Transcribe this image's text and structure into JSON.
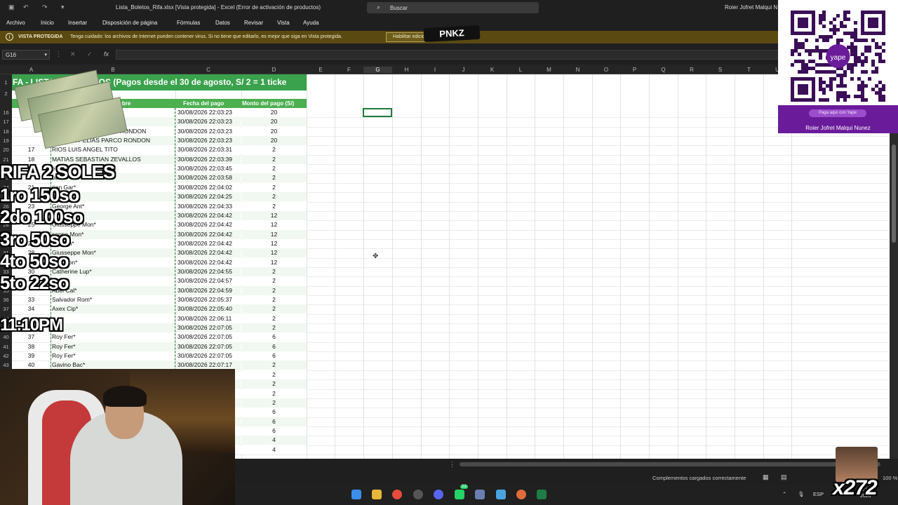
{
  "window": {
    "title": "Lista_Boletos_Rifa.xlsx  [Vista protegida]  -  Excel (Error de activación de productos)",
    "search_placeholder": "Buscar",
    "user": "Roier Jofret Malqui N"
  },
  "ribbon": {
    "tabs": [
      "Archivo",
      "Inicio",
      "Insertar",
      "Disposición de página",
      "Fórmulas",
      "Datos",
      "Revisar",
      "Vista",
      "Ayuda"
    ]
  },
  "protected_view": {
    "label": "VISTA PROTEGIDA",
    "message": "Tenga cuidado: los archivos de Internet pueden contener virus. Si no tiene que editarlo, es mejor que siga en Vista protegida.",
    "enable_button": "Habilitar edición"
  },
  "formula_bar": {
    "name_box": "G16",
    "fx": "fx",
    "cancel": "✕",
    "enter": "✓"
  },
  "columns": [
    "A",
    "B",
    "C",
    "D",
    "E",
    "F",
    "G",
    "H",
    "I",
    "J",
    "K",
    "L",
    "M",
    "N",
    "O",
    "P",
    "Q",
    "R",
    "S",
    "T",
    "U"
  ],
  "sheet": {
    "banner": "FA - LISTA DE BOLETOS (Pagos desde el 30 de agosto, S/ 2 = 1 ticke",
    "headers": {
      "b": "nombre",
      "c": "Fecha del pago",
      "d": "Monto del pago (S/)"
    },
    "row_numbers": [
      "1",
      "2",
      "16",
      "17",
      "18",
      "19",
      "20",
      "21",
      "22",
      "23",
      "24",
      "25",
      "26",
      "27",
      "28",
      "29",
      "30",
      "31",
      "32",
      "33",
      "34",
      "35",
      "36",
      "37",
      "38",
      "39",
      "40",
      "41",
      "42",
      "43"
    ],
    "rows": [
      {
        "a": "",
        "b": "ELIAS PARCO RONDON",
        "c": "30/08/2026 22:03:23",
        "d": "20"
      },
      {
        "a": "",
        "b": "Y ELIAS PARCO RONDON",
        "c": "30/08/2026 22:03:23",
        "d": "20"
      },
      {
        "a": "",
        "b": "NTHONY ELIAS PARCO RONDON",
        "c": "30/08/2026 22:03:23",
        "d": "20"
      },
      {
        "a": "",
        "b": "ANTHONY ELIAS PARCO RONDON",
        "c": "30/08/2026 22:03:23",
        "d": "20"
      },
      {
        "a": "17",
        "b": "RIOS LUIS ANGEL TITO",
        "c": "30/08/2026 22:03:31",
        "d": "2"
      },
      {
        "a": "18",
        "b": "MATIAS SEBASTIAN ZEVALLOS",
        "c": "30/08/2026 22:03:39",
        "d": "2"
      },
      {
        "a": "",
        "b": "el",
        "c": "30/08/2026 22:03:45",
        "d": "2"
      },
      {
        "a": "",
        "b": "obb",
        "c": "30/08/2026 22:03:58",
        "d": "2"
      },
      {
        "a": "21",
        "b": "rian Gar*",
        "c": "30/08/2026 22:04:02",
        "d": "2"
      },
      {
        "a": "",
        "b": "l*",
        "c": "30/08/2026 22:04:25",
        "d": "2"
      },
      {
        "a": "23",
        "b": "George Ant*",
        "c": "30/08/2026 22:04:33",
        "d": "2"
      },
      {
        "a": "",
        "b": "on*",
        "c": "30/08/2026 22:04:42",
        "d": "12"
      },
      {
        "a": "25",
        "b": "Giusseppe Mon*",
        "c": "30/08/2026 22:04:42",
        "d": "12"
      },
      {
        "a": "",
        "b": "seppe Mon*",
        "c": "30/08/2026 22:04:42",
        "d": "12"
      },
      {
        "a": "27",
        "b": "pe Mon*",
        "c": "30/08/2026 22:04:42",
        "d": "12"
      },
      {
        "a": "28",
        "b": "Giusseppe Mon*",
        "c": "30/08/2026 22:04:42",
        "d": "12"
      },
      {
        "a": "",
        "b": "ppe Mon*",
        "c": "30/08/2026 22:04:42",
        "d": "12"
      },
      {
        "a": "30",
        "b": "Catherine Lup*",
        "c": "30/08/2026 22:04:55",
        "d": "2"
      },
      {
        "a": "",
        "b": "",
        "c": "30/08/2026 22:04:57",
        "d": "2"
      },
      {
        "a": "",
        "b": "Abel Cal*",
        "c": "30/08/2026 22:04:59",
        "d": "2"
      },
      {
        "a": "33",
        "b": "Salvador Rom*",
        "c": "30/08/2026 22:05:37",
        "d": "2"
      },
      {
        "a": "34",
        "b": "Axex Cip*",
        "c": "30/08/2026 22:05:40",
        "d": "2"
      },
      {
        "a": "",
        "b": "",
        "c": "30/08/2026 22:06:11",
        "d": "2"
      },
      {
        "a": "",
        "b": "",
        "c": "30/08/2026 22:07:05",
        "d": "2"
      },
      {
        "a": "37",
        "b": "Roy Fer*",
        "c": "30/08/2026 22:07:05",
        "d": "6"
      },
      {
        "a": "38",
        "b": "Roy Fer*",
        "c": "30/08/2026 22:07:05",
        "d": "6"
      },
      {
        "a": "39",
        "b": "Roy Fer*",
        "c": "30/08/2026 22:07:05",
        "d": "6"
      },
      {
        "a": "40",
        "b": "Gavino Bac*",
        "c": "30/08/2026 22:07:17",
        "d": "2"
      },
      {
        "a": "",
        "b": "",
        "c": "",
        "d": "2"
      },
      {
        "a": "",
        "b": "",
        "c": "",
        "d": "2"
      },
      {
        "a": "",
        "b": "",
        "c": "",
        "d": "2"
      },
      {
        "a": "",
        "b": "",
        "c": "",
        "d": "2"
      },
      {
        "a": "",
        "b": "",
        "c": "",
        "d": "6"
      },
      {
        "a": "",
        "b": "",
        "c": "",
        "d": "6"
      },
      {
        "a": "",
        "b": "",
        "c": "",
        "d": "6"
      },
      {
        "a": "",
        "b": "",
        "c": "",
        "d": "4"
      },
      {
        "a": "",
        "b": "",
        "c": "",
        "d": "4"
      }
    ]
  },
  "overlay": {
    "title": "RIFA 2 SOLES",
    "prizes": [
      "1ro 150so",
      "2do 100so",
      "3ro 50so",
      "4to 50so",
      "5to 22so"
    ],
    "time": "11:10PM"
  },
  "stream": {
    "logo": "PNKZ",
    "badge": "x272"
  },
  "qr_card": {
    "pay_label": "Paga aquí con Yape",
    "name": "Roier Jofret Malqui Nunez",
    "brand": "yape"
  },
  "status": {
    "message": "Complementos cargados correctamente",
    "zoom": "100 %"
  },
  "taskbar": {
    "lang": "ESP",
    "clock_time": "0:03",
    "clock_date": "2026",
    "badge_count": "23"
  },
  "colors": {
    "green_banner": "#3aa24d",
    "header_green": "#4caf50",
    "protected_bar": "#5a4a12",
    "yape_purple": "#6a1b9a"
  }
}
